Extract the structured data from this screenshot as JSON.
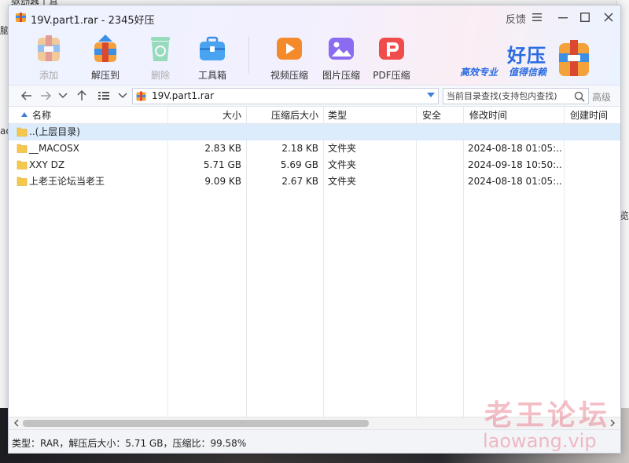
{
  "background": {
    "top_label": "驱动器工具",
    "left_fragment_1": "脑",
    "left_fragment_2": "ac",
    "right_fragment": "预览"
  },
  "window": {
    "title": "19V.part1.rar - 2345好压",
    "feedback": "反馈"
  },
  "toolbar": {
    "items": [
      {
        "label": "添加",
        "icon": "add-archive-icon",
        "enabled": false
      },
      {
        "label": "解压到",
        "icon": "extract-icon",
        "enabled": true
      },
      {
        "label": "删除",
        "icon": "recycle-icon",
        "enabled": false
      },
      {
        "label": "工具箱",
        "icon": "toolbox-icon",
        "enabled": true
      },
      {
        "label": "视频压缩",
        "icon": "video-compress-icon",
        "enabled": true
      },
      {
        "label": "图片压缩",
        "icon": "image-compress-icon",
        "enabled": true
      },
      {
        "label": "PDF压缩",
        "icon": "pdf-compress-icon",
        "enabled": true
      }
    ]
  },
  "brand": {
    "name": "好压",
    "slogan1": "高效专业",
    "slogan2": "值得信赖"
  },
  "navbar": {
    "path": "19V.part1.rar",
    "search_placeholder": "当前目录查找(支持包内查找)",
    "advanced_label": "高级"
  },
  "columns": {
    "name": "名称",
    "size": "大小",
    "packed": "压缩后大小",
    "type": "类型",
    "security": "安全",
    "modified": "修改时间",
    "created": "创建时间"
  },
  "rows": [
    {
      "name": "..(上层目录)",
      "size": "",
      "packed": "",
      "type": "",
      "security": "",
      "modified": "",
      "created": ""
    },
    {
      "name": "__MACOSX",
      "size": "2.83 KB",
      "packed": "2.18 KB",
      "type": "文件夹",
      "security": "",
      "modified": "2024-08-18 01:05:...",
      "created": ""
    },
    {
      "name": "XXY DZ",
      "size": "5.71 GB",
      "packed": "5.69 GB",
      "type": "文件夹",
      "security": "",
      "modified": "2024-09-18 10:50:...",
      "created": ""
    },
    {
      "name": "上老王论坛当老王",
      "size": "9.09 KB",
      "packed": "2.67 KB",
      "type": "文件夹",
      "security": "",
      "modified": "2024-08-18 01:05:...",
      "created": ""
    }
  ],
  "status": {
    "text": "类型：RAR，解压后大小：5.71 GB，压缩比：99.58%"
  },
  "watermark": {
    "line1": "老王论坛",
    "line2": "laowang.vip"
  }
}
